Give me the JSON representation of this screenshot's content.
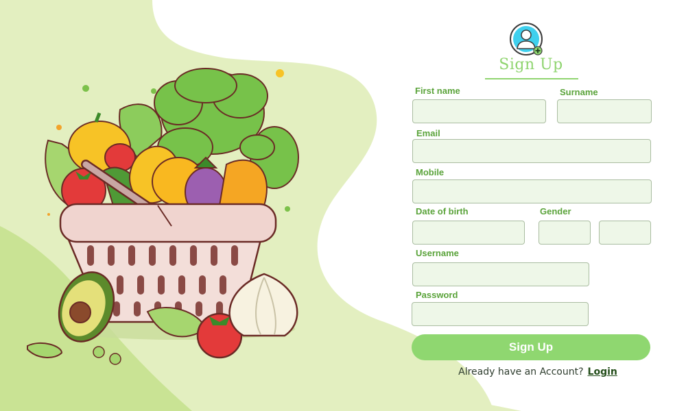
{
  "form": {
    "title": "Sign Up",
    "first_name_label": "First name",
    "surname_label": "Surname",
    "email_label": "Email",
    "mobile_label": "Mobile",
    "dob_label": "Date of birth",
    "gender_label": "Gender",
    "username_label": "Username",
    "password_label": "Password",
    "first_name_value": "",
    "surname_value": "",
    "email_value": "",
    "mobile_value": "",
    "dob_value": "",
    "gender_value_1": "",
    "gender_value_2": "",
    "username_value": "",
    "password_value": "",
    "submit_label": "Sign Up",
    "login_prompt": "Already have an Account?",
    "login_link": "Login"
  },
  "colors": {
    "accent_green": "#8fd770",
    "label_green": "#5aa33a",
    "field_bg": "#eef7e8",
    "background_blob": "#e3efc0"
  },
  "icons": [
    "user-avatar-icon",
    "plus-badge-icon"
  ]
}
